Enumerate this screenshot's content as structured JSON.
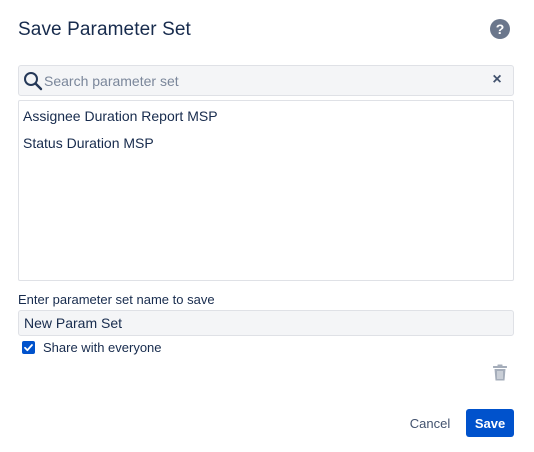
{
  "dialog": {
    "title": "Save Parameter Set",
    "help_icon": "help-icon",
    "help_glyph": "?"
  },
  "search": {
    "placeholder": "Search parameter set",
    "value": "",
    "icon": "search-icon",
    "clear_icon": "close-icon",
    "clear_glyph": "×"
  },
  "parameter_sets": [
    {
      "label": "Assignee Duration Report MSP"
    },
    {
      "label": "Status Duration MSP"
    }
  ],
  "name_field": {
    "label": "Enter parameter set name to save",
    "value": "New Param Set"
  },
  "share": {
    "label": "Share with everyone",
    "checked": true
  },
  "delete_icon": "trash-icon",
  "actions": {
    "cancel_label": "Cancel",
    "save_label": "Save"
  },
  "colors": {
    "primary": "#0052cc",
    "text": "#172b4d",
    "muted": "#6b778c",
    "field_bg": "#f4f5f7",
    "border": "#dfe1e6"
  }
}
